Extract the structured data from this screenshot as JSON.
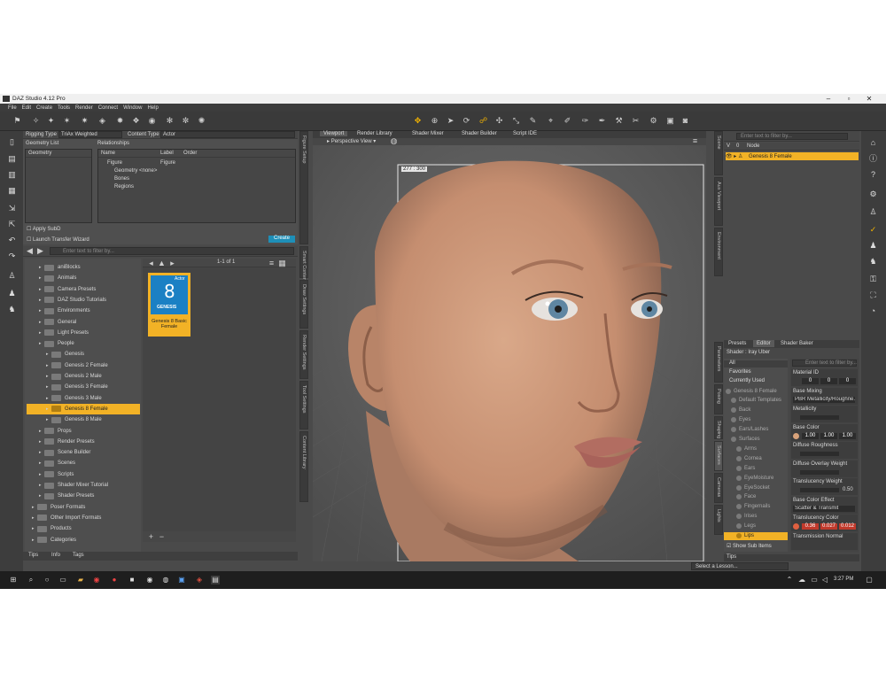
{
  "window": {
    "title": "DAZ Studio 4.12 Pro",
    "min": "–",
    "max": "▫",
    "close": "✕"
  },
  "menu": [
    "File",
    "Edit",
    "Create",
    "Tools",
    "Render",
    "Connect",
    "Window",
    "Help"
  ],
  "toolbar_icons": [
    "scene-icon",
    "pose-icon",
    "node-icon",
    "joint-icon",
    "light-icon",
    "camera-icon",
    "render-icon",
    "prim-icon",
    "morph-icon",
    "weight-icon",
    "geometry-icon"
  ],
  "rigging": {
    "rigging_type_label": "Rigging Type",
    "rigging_type_value": "TriAx Weighted",
    "content_type_label": "Content Type",
    "content_type_value": "Actor",
    "geometry_list": "Geometry List",
    "geometry_col": "Geometry",
    "relationships": "Relationships",
    "cols": {
      "name": "Name",
      "label": "Label",
      "order": "Order"
    },
    "tree": [
      {
        "name": "Figure",
        "label": "Figure"
      },
      {
        "name": "Geometry <none>",
        "label": ""
      },
      {
        "name": "Bones",
        "label": ""
      },
      {
        "name": "Regions",
        "label": ""
      }
    ],
    "apply_subd": "Apply SubD",
    "launch_wizard": "Launch Transfer Wizard",
    "create": "Create",
    "vtab": "Figure Setup"
  },
  "library": {
    "search_placeholder": "Enter text to filter by...",
    "folders": [
      "aniBlocks",
      "Animals",
      "Camera Presets",
      "DAZ Studio Tutorials",
      "Environments",
      "General",
      "Light Presets",
      "People",
      "Genesis",
      "Genesis 2 Female",
      "Genesis 2 Male",
      "Genesis 3 Female",
      "Genesis 3 Male",
      "Genesis 8 Female",
      "Genesis 8 Male",
      "Props",
      "Render Presets",
      "Scene Builder",
      "Scenes",
      "Scripts",
      "Shader Mixer Tutorial",
      "Shader Presets",
      "Poser Formats",
      "Other Import Formats",
      "Products",
      "Categories"
    ],
    "pager": "1-1 of 1",
    "thumb_caption": "Genesis 8 Basic Female",
    "thumb_badge": "Actor",
    "thumb_brand": "GENESIS",
    "thumb_num": "8",
    "bottom_tabs": [
      "Tips",
      "Info",
      "Tags"
    ],
    "vtabs": [
      "Smart Content",
      "Draw Settings",
      "Render Settings",
      "Tool Settings",
      "Content Library"
    ]
  },
  "viewport": {
    "tabs": [
      "Viewport",
      "Render Library",
      "Shader Mixer",
      "Shader Builder",
      "Script IDE"
    ],
    "view_label": "Perspective View",
    "dims": "277 : 300"
  },
  "scene": {
    "search_placeholder": "Enter text to filter by...",
    "col_node": "Node",
    "selected_node": "Genesis 8 Female",
    "vtabs": [
      "Scene",
      "Aux Viewport",
      "Environment"
    ]
  },
  "surfaces": {
    "tabs": [
      "Presets",
      "Editor",
      "Shader Baker"
    ],
    "shader": "Shader : Iray Uber",
    "left_list": [
      "All",
      "Favorites",
      "Currently Used"
    ],
    "tree": [
      "Genesis 8 Female",
      "Default Templates",
      "Back",
      "Eyes",
      "Ears/Lashes",
      "Surfaces",
      "Arms",
      "Cornea",
      "Ears",
      "EyeMoisture",
      "EyeSocket",
      "Face",
      "Fingernails",
      "Irises",
      "Legs",
      "Lips"
    ],
    "selected": "Lips",
    "show_sub": "Show Sub Items",
    "filter_placeholder": "Enter text to filter by...",
    "props": {
      "material_id": "Material ID",
      "material_vals": [
        "0",
        "0",
        "0"
      ],
      "base_mixing": "Base Mixing",
      "base_mixing_val": "PBR Metallicity/Roughne...",
      "metallicity": "Metallicity",
      "base_color": "Base Color",
      "base_color_vals": [
        "1.00",
        "1.00",
        "1.00"
      ],
      "diffuse_roughness": "Diffuse Roughness",
      "diffuse_overlay": "Diffuse Overlay Weight",
      "translucency_weight": "Translucency Weight",
      "translucency_val": "0.50",
      "base_color_effect": "Base Color Effect",
      "base_color_effect_val": "Scatter & Transmit",
      "translucency_color": "Translucency Color",
      "translucency_vals": [
        "0.36",
        "0.027",
        "0.012"
      ],
      "transmission": "Transmission Normal"
    },
    "lesson": "Select a Lesson...",
    "tips": "Tips",
    "vtabs": [
      "Parameters",
      "Posing",
      "Shaping",
      "Surfaces",
      "Cameras",
      "Lights"
    ]
  },
  "taskbar": {
    "time": "3:27 PM"
  }
}
